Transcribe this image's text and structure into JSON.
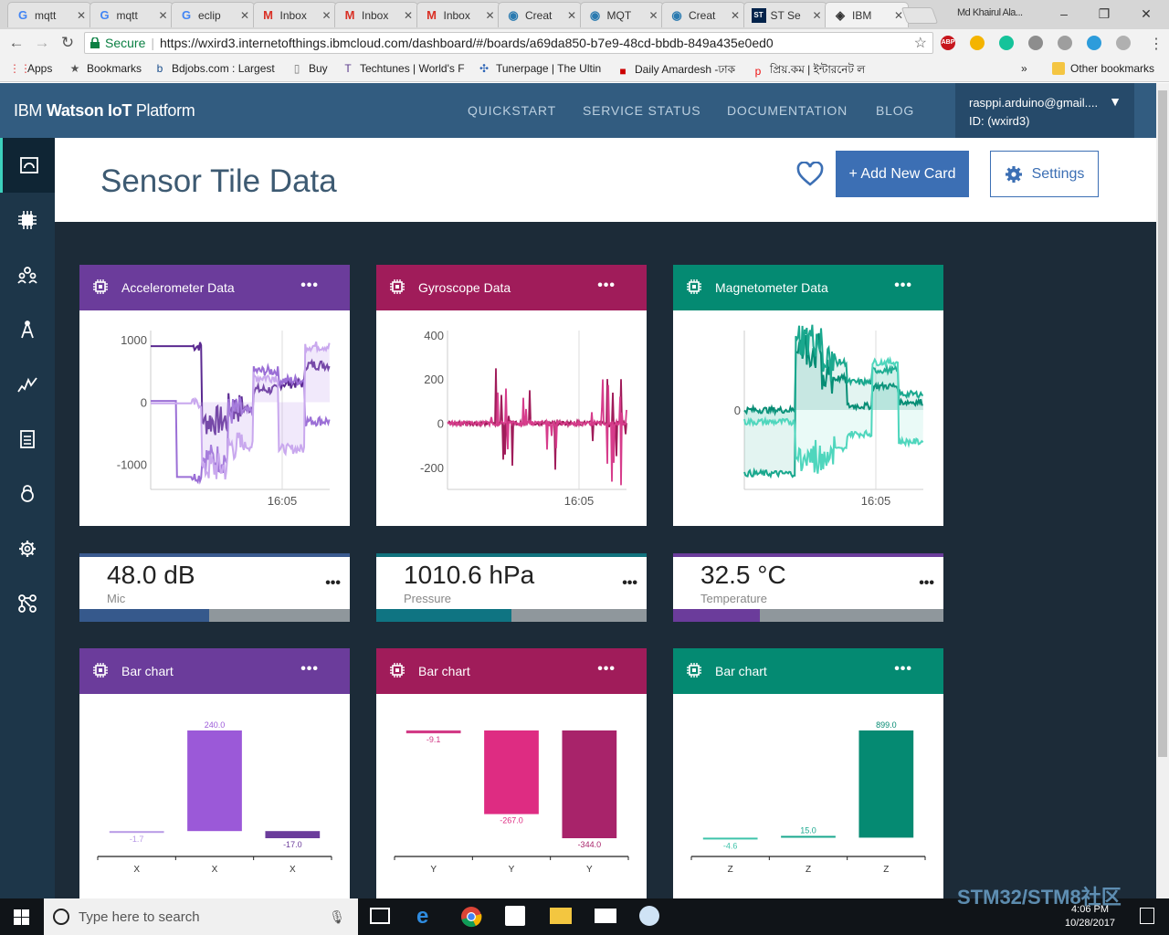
{
  "browser": {
    "tabs": [
      {
        "icon": "google-icon",
        "label": "mqtt"
      },
      {
        "icon": "google-icon",
        "label": "mqtt"
      },
      {
        "icon": "google-icon",
        "label": "eclip"
      },
      {
        "icon": "gmail-icon",
        "label": "Inbox"
      },
      {
        "icon": "gmail-icon",
        "label": "Inbox"
      },
      {
        "icon": "gmail-icon",
        "label": "Inbox"
      },
      {
        "icon": "globe-icon",
        "label": "Creat"
      },
      {
        "icon": "globe-icon",
        "label": "MQT"
      },
      {
        "icon": "globe-icon",
        "label": "Creat"
      },
      {
        "icon": "st-icon",
        "label": "ST Se"
      },
      {
        "icon": "ibm-icon",
        "label": "IBM"
      }
    ],
    "profile": "Md Khairul Ala...",
    "secure_label": "Secure",
    "url": "https://wxird3.internetofthings.ibmcloud.com/dashboard/#/boards/a69da850-b7e9-48cd-bbdb-849a435e0ed0",
    "extensions": [
      {
        "name": "adblock-icon",
        "label": "ABP",
        "color": "#c7161d"
      },
      {
        "name": "coin-icon",
        "label": "",
        "color": "#f4b400"
      },
      {
        "name": "grammarly-icon",
        "label": "",
        "color": "#15c39a"
      },
      {
        "name": "printer-icon",
        "label": "",
        "color": "#8d8d8d"
      },
      {
        "name": "inbox-icon",
        "label": "",
        "color": "#9e9e9e"
      },
      {
        "name": "cloud-icon",
        "label": "",
        "color": "#2d9cdb"
      },
      {
        "name": "mail-icon",
        "label": "",
        "color": "#b0b0b0"
      }
    ],
    "bookmarks": [
      {
        "icon": "apps-icon",
        "label": "Apps"
      },
      {
        "icon": "star-icon",
        "label": "Bookmarks"
      },
      {
        "icon": "bdjobs-icon",
        "label": "Bdjobs.com : Largest"
      },
      {
        "icon": "page-icon",
        "label": "Buy"
      },
      {
        "icon": "techtunes-icon",
        "label": "Techtunes | World's F"
      },
      {
        "icon": "tunerpage-icon",
        "label": "Tunerpage | The Ultin"
      },
      {
        "icon": "amardesh-icon",
        "label": "Daily Amardesh -ঢাক"
      },
      {
        "icon": "priyo-icon",
        "label": "প্রিয়.কম | ইন্টারনেট ল"
      }
    ],
    "bookmarks_more": "»",
    "other_bookmarks": "Other bookmarks"
  },
  "header": {
    "brand_prefix": "IBM",
    "brand_bold": "Watson IoT",
    "brand_suffix": "Platform",
    "nav": [
      "QUICKSTART",
      "SERVICE STATUS",
      "DOCUMENTATION",
      "BLOG"
    ],
    "user_email": "rasppi.arduino@gmail....",
    "user_id": "ID: (wxird3)"
  },
  "sidebar": [
    "boards-icon",
    "devices-icon",
    "members-icon",
    "rules-icon",
    "usage-icon",
    "logs-icon",
    "security-icon",
    "settings-icon",
    "extensions-icon"
  ],
  "board": {
    "title": "Sensor Tile Data",
    "add_card_label": "+ Add New Card",
    "settings_label": "Settings"
  },
  "colors": {
    "purple": "#6b3c9b",
    "magenta": "#a01c5a",
    "teal": "#048a72"
  },
  "cards": {
    "accel": {
      "title": "Accelerometer Data"
    },
    "gyro": {
      "title": "Gyroscope Data"
    },
    "mag": {
      "title": "Magnetometer Data"
    },
    "mic": {
      "value": "48.0 dB",
      "label": "Mic",
      "level": 0.48
    },
    "pressure": {
      "value": "1010.6 hPa",
      "label": "Pressure",
      "level": 0.5
    },
    "temp": {
      "value": "32.5 °C",
      "label": "Temperature",
      "level": 0.32
    },
    "barx": {
      "title": "Bar chart"
    },
    "bary": {
      "title": "Bar chart"
    },
    "barz": {
      "title": "Bar chart"
    }
  },
  "chart_data": [
    {
      "type": "line",
      "id": "accel",
      "xticks": [
        "16:05"
      ],
      "yticks": [
        1000,
        0,
        -1000
      ],
      "ylim": [
        -1400,
        1150
      ],
      "series_colors": [
        "#5b2a91",
        "#9b6fd6",
        "#c9a8ee"
      ]
    },
    {
      "type": "line",
      "id": "gyro",
      "xticks": [
        "16:05"
      ],
      "yticks": [
        400,
        200,
        0,
        -200
      ],
      "ylim": [
        -300,
        420
      ],
      "series_colors": [
        "#a01c5a",
        "#d63c8b"
      ]
    },
    {
      "type": "line",
      "id": "mag",
      "xticks": [
        "16:05"
      ],
      "yticks": [
        0
      ],
      "ylim": [
        -1,
        1
      ],
      "series_colors": [
        "#048a72",
        "#1aa88e",
        "#4fd6bd"
      ]
    },
    {
      "type": "bar",
      "id": "barx",
      "categories": [
        "X",
        "X",
        "X"
      ],
      "values": [
        -1.7,
        240.0,
        -17.0
      ],
      "labels": [
        "-1.7",
        "240.0",
        "-17.0"
      ],
      "colors": [
        "#b89ae6",
        "#9b59d8",
        "#6b3c9b"
      ]
    },
    {
      "type": "bar",
      "id": "bary",
      "categories": [
        "Y",
        "Y",
        "Y"
      ],
      "values": [
        -9.1,
        -267.0,
        -344.0
      ],
      "labels": [
        "-9.1",
        "-267.0",
        "-344.0"
      ],
      "colors": [
        "#d23a86",
        "#de2c82",
        "#a8236a"
      ]
    },
    {
      "type": "bar",
      "id": "barz",
      "categories": [
        "Z",
        "Z",
        "Z"
      ],
      "values": [
        -4.6,
        15.0,
        899.0
      ],
      "labels": [
        "-4.6",
        "15.0",
        "899.0"
      ],
      "colors": [
        "#3ec3aa",
        "#1aa88e",
        "#058a72"
      ]
    }
  ],
  "taskbar": {
    "search_placeholder": "Type here to search",
    "time": "4:06 PM",
    "date": "10/28/2017"
  },
  "watermark": "STM32/STM8社区"
}
